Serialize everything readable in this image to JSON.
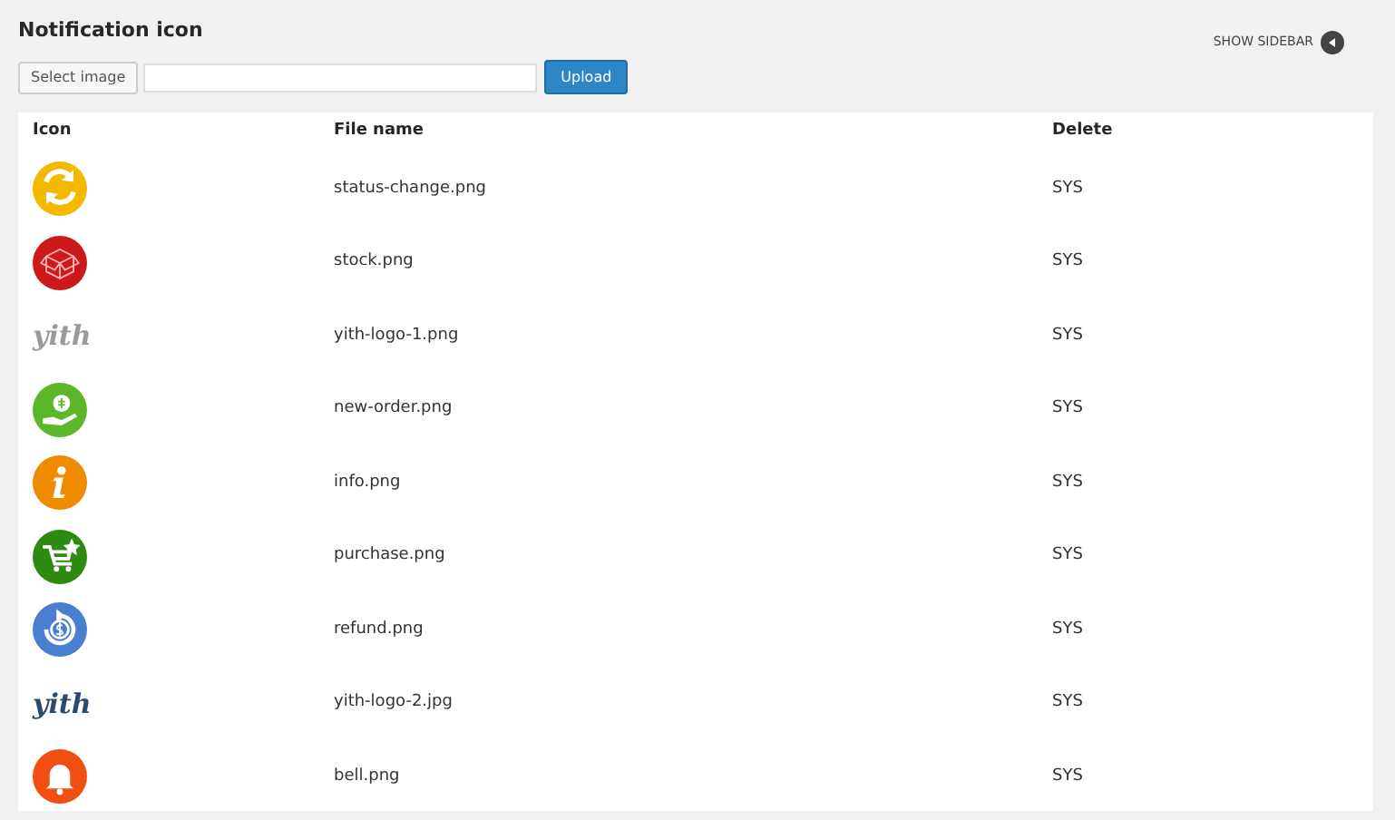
{
  "title": "Notification icon",
  "sidebar_toggle": {
    "label": "SHOW SIDEBAR"
  },
  "upload": {
    "select_button": "Select image",
    "upload_button": "Upload"
  },
  "table": {
    "columns": [
      "Icon",
      "File name",
      "Delete"
    ],
    "rows": [
      {
        "kind": "refresh",
        "color": "#f5b800",
        "file_name": "status-change.png",
        "delete": "SYS"
      },
      {
        "kind": "box",
        "color": "#cc1a1a",
        "file_name": "stock.png",
        "delete": "SYS"
      },
      {
        "kind": "logo",
        "logo_text": "yith",
        "color": "#9a9a9a",
        "file_name": "yith-logo-1.png",
        "delete": "SYS"
      },
      {
        "kind": "money",
        "color": "#5cb82a",
        "file_name": "new-order.png",
        "delete": "SYS"
      },
      {
        "kind": "info",
        "color": "#f08a00",
        "file_name": "info.png",
        "delete": "SYS"
      },
      {
        "kind": "cart",
        "color": "#2f8a12",
        "file_name": "purchase.png",
        "delete": "SYS"
      },
      {
        "kind": "refund",
        "color": "#4a7fd0",
        "file_name": "refund.png",
        "delete": "SYS"
      },
      {
        "kind": "logo",
        "logo_text": "yith",
        "color": "#2c4a6e",
        "file_name": "yith-logo-2.jpg",
        "delete": "SYS"
      },
      {
        "kind": "bell",
        "color": "#f04e12",
        "file_name": "bell.png",
        "delete": "SYS"
      }
    ]
  }
}
